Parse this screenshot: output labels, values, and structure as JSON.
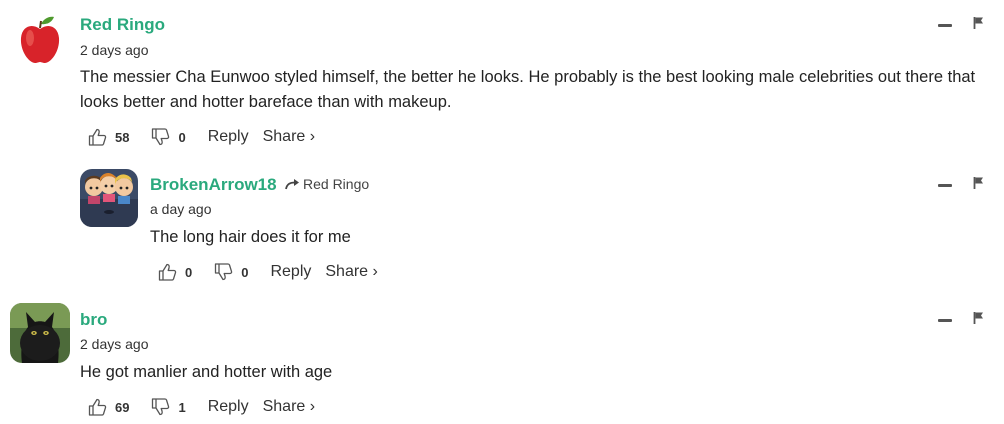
{
  "comments": [
    {
      "username": "Red Ringo",
      "time": "2 days ago",
      "text": "The messier Cha Eunwoo styled himself, the better he looks. He probably is the best looking male celebrities out there that looks better and hotter bareface than with makeup.",
      "upvotes": "58",
      "downvotes": "0",
      "reply_label": "Reply",
      "share_label": "Share ›",
      "avatar_icon": "apple-icon"
    },
    {
      "username": "BrokenArrow18",
      "reply_to": "Red Ringo",
      "time": "a day ago",
      "text": "The long hair does it for me",
      "upvotes": "0",
      "downvotes": "0",
      "reply_label": "Reply",
      "share_label": "Share ›",
      "avatar_icon": "cartoon-group-icon"
    },
    {
      "username": "bro",
      "time": "2 days ago",
      "text": "He got manlier and hotter with age",
      "upvotes": "69",
      "downvotes": "1",
      "reply_label": "Reply",
      "share_label": "Share ›",
      "avatar_icon": "black-cat-icon"
    }
  ],
  "colors": {
    "username": "#2aa97d",
    "text": "#222222",
    "icon": "#555555"
  }
}
